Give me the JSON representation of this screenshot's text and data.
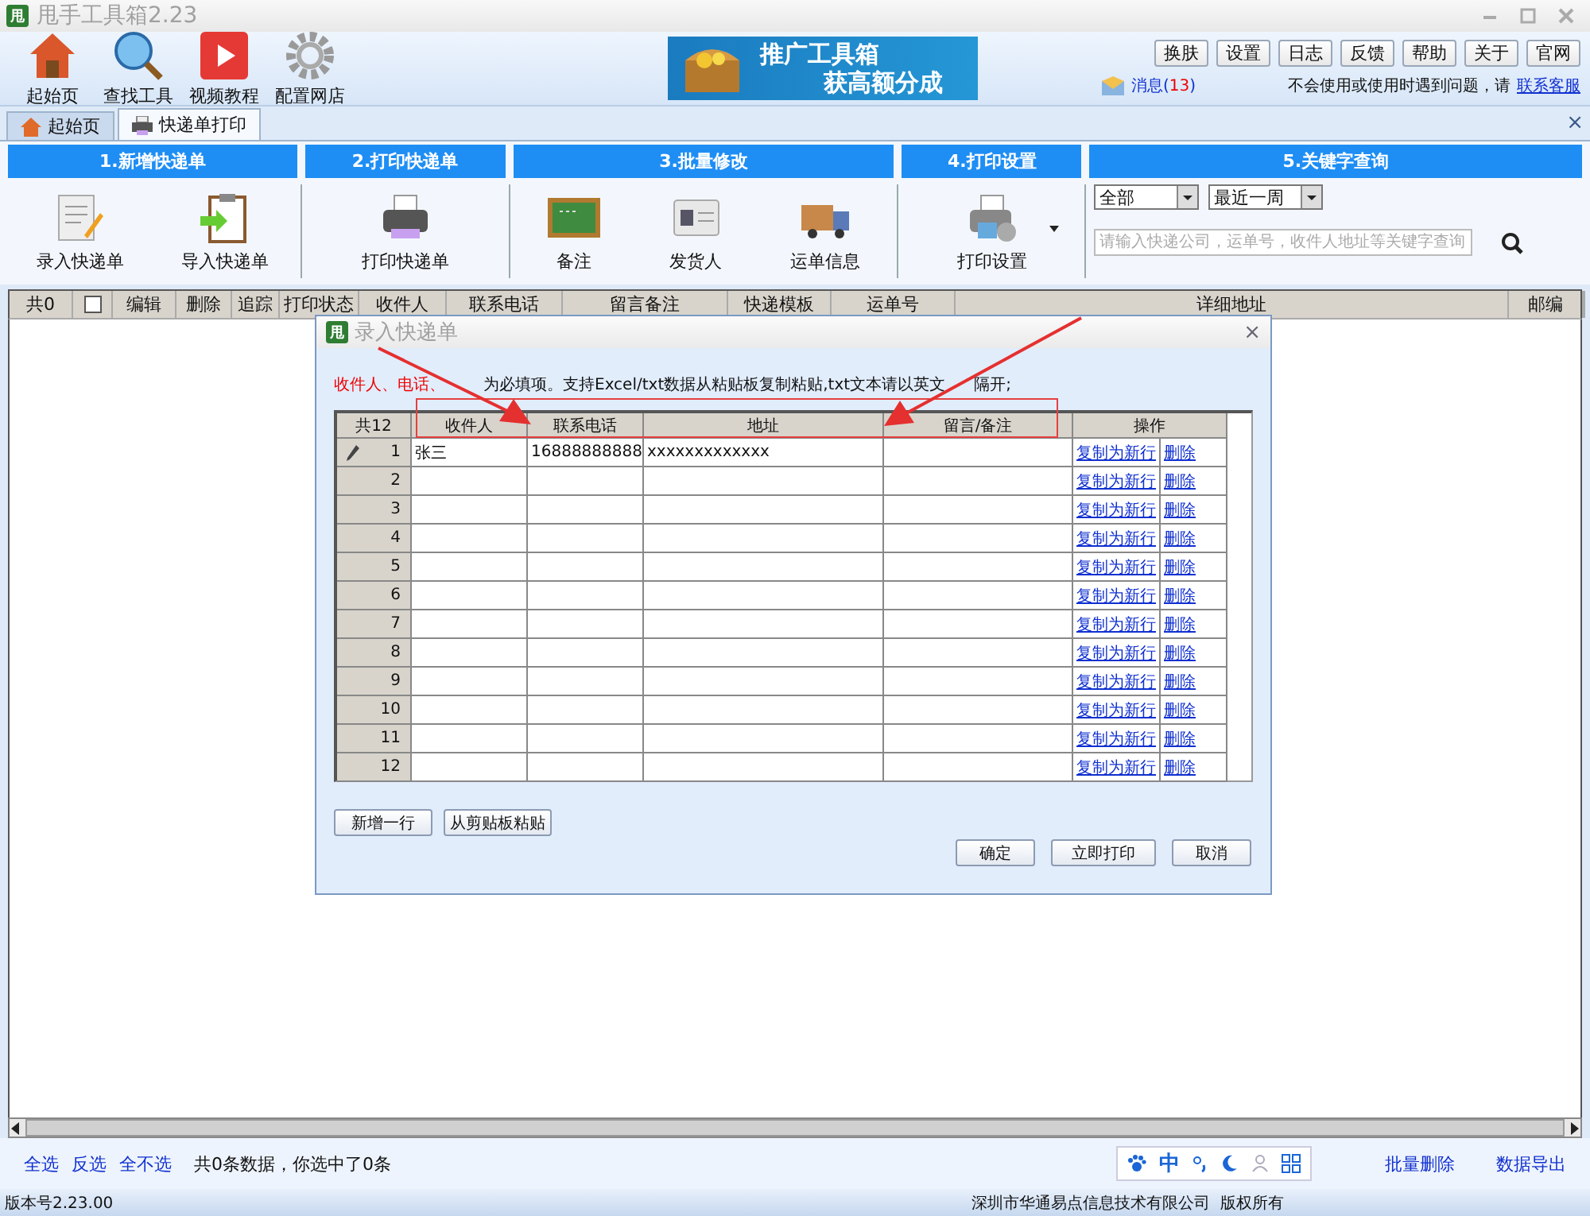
{
  "window": {
    "title": "甩手工具箱2.23",
    "app_icon": "甩"
  },
  "toolbar": [
    {
      "label": "起始页",
      "kind": "home"
    },
    {
      "label": "查找工具",
      "kind": "search"
    },
    {
      "label": "视频教程",
      "kind": "video"
    },
    {
      "label": "配置网店",
      "kind": "gear"
    }
  ],
  "banner": {
    "line1": "推广工具箱",
    "line2": "获高额分成"
  },
  "top_buttons": [
    "换肤",
    "设置",
    "日志",
    "反馈",
    "帮助",
    "关于",
    "官网"
  ],
  "messages": {
    "label": "消息(",
    "count": "13",
    "suffix": ")"
  },
  "help": {
    "text": "不会使用或使用时遇到问题，请",
    "link": "联系客服"
  },
  "tabs": [
    {
      "label": "起始页",
      "selected": false,
      "kind": "home"
    },
    {
      "label": "快递单打印",
      "selected": true,
      "kind": "printer"
    }
  ],
  "tab_close": "×",
  "ribbon": [
    {
      "header": "1.新增快递单",
      "items": [
        {
          "label": "录入快递单",
          "kind": "form"
        },
        {
          "label": "导入快递单",
          "kind": "import"
        }
      ]
    },
    {
      "header": "2.打印快递单",
      "items": [
        {
          "label": "打印快递单",
          "kind": "printer"
        }
      ]
    },
    {
      "header": "3.批量修改",
      "items": [
        {
          "label": "备注",
          "kind": "board"
        },
        {
          "label": "发货人",
          "kind": "card"
        },
        {
          "label": "运单信息",
          "kind": "truck"
        }
      ]
    },
    {
      "header": "4.打印设置",
      "items": [
        {
          "label": "打印设置",
          "kind": "printer-settings"
        }
      ]
    }
  ],
  "query": {
    "header": "5.关键字查询",
    "company": "全部",
    "period": "最近一周",
    "placeholder": "请输入快递公司，运单号，收件人地址等关键字查询"
  },
  "table": {
    "count": "共0",
    "select_all": false,
    "columns": [
      "编辑",
      "删除",
      "追踪",
      "打印状态",
      "收件人",
      "联系电话",
      "留言备注",
      "快递模板",
      "运单号",
      "详细地址",
      "邮编"
    ]
  },
  "footer": {
    "links": [
      "全选",
      "反选",
      "全不选"
    ],
    "summary": "共0条数据，你选中了0条",
    "ime": "中",
    "actions": [
      "批量删除",
      "数据导出"
    ]
  },
  "status_bar": {
    "version": "版本号2.23.00",
    "copyright": "深圳市华通易点信息技术有限公司  版权所有"
  },
  "dialog": {
    "title": "录入快递单",
    "app_icon": "甩",
    "close": "×",
    "notice_required": "收件人、电话、",
    "notice": "为必填项。支持Excel/txt数据从粘贴板复制粘贴,txt文本请以英文",
    "notice_end": "隔开;",
    "count": "共12",
    "columns": [
      "收件人",
      "联系电话",
      "地址",
      "留言/备注",
      "操作"
    ],
    "rows": [
      {
        "number": "1",
        "editing": true,
        "recipient": "张三",
        "phone": "16888888888",
        "address": "xxxxxxxxxxxxx",
        "copy": "复制为新行",
        "delete": "删除"
      },
      {
        "number": "2",
        "editing": false,
        "copy": "复制为新行",
        "delete": "删除"
      },
      {
        "number": "3",
        "editing": false,
        "copy": "复制为新行",
        "delete": "删除"
      },
      {
        "number": "4",
        "editing": false,
        "copy": "复制为新行",
        "delete": "删除"
      },
      {
        "number": "5",
        "editing": false,
        "copy": "复制为新行",
        "delete": "删除"
      },
      {
        "number": "6",
        "editing": false,
        "copy": "复制为新行",
        "delete": "删除"
      },
      {
        "number": "7",
        "editing": false,
        "copy": "复制为新行",
        "delete": "删除"
      },
      {
        "number": "8",
        "editing": false,
        "copy": "复制为新行",
        "delete": "删除"
      },
      {
        "number": "9",
        "editing": false,
        "copy": "复制为新行",
        "delete": "删除"
      },
      {
        "number": "10",
        "editing": false,
        "copy": "复制为新行",
        "delete": "删除"
      },
      {
        "number": "11",
        "editing": false,
        "copy": "复制为新行",
        "delete": "删除"
      },
      {
        "number": "12",
        "editing": false,
        "copy": "复制为新行",
        "delete": "删除"
      }
    ],
    "left_buttons": [
      "新增一行",
      "从剪贴板粘贴"
    ],
    "buttons": [
      "确定",
      "立即打印",
      "取消"
    ]
  }
}
